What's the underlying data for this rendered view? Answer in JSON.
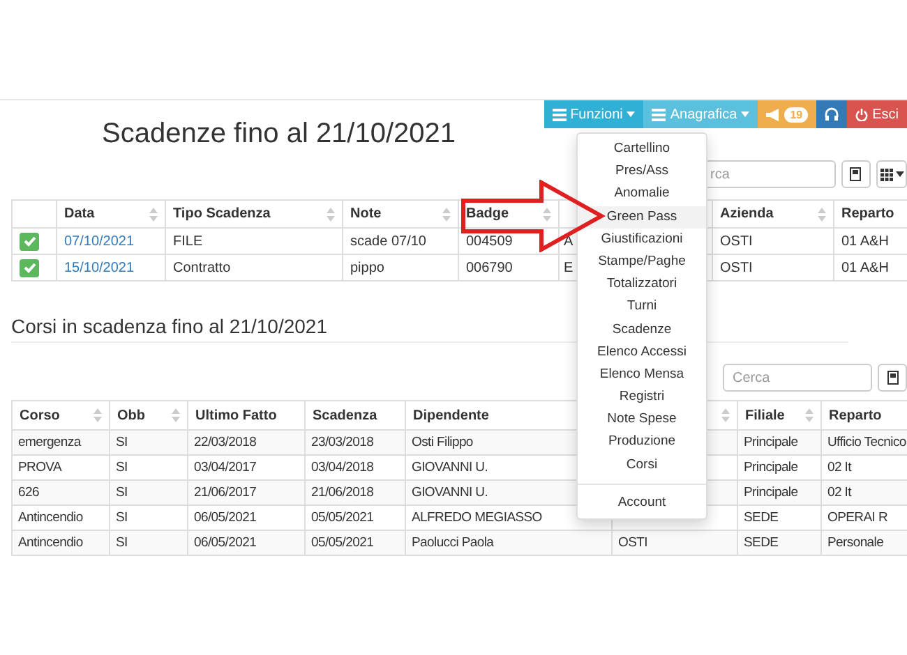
{
  "navbar": {
    "buttons": [
      {
        "kind": "menu",
        "label": "Funzioni",
        "color": "#31b0d5"
      },
      {
        "kind": "menu",
        "label": "Anagrafica",
        "color": "#5bc0de"
      },
      {
        "kind": "badge",
        "count": "19",
        "color": "#f0ad4e"
      },
      {
        "kind": "headset",
        "color": "#337ab7"
      },
      {
        "kind": "power",
        "label": "Esci",
        "color": "#d9534f"
      }
    ]
  },
  "page_title": "Scadenze fino al 21/10/2021",
  "scadenze": {
    "search": {
      "placeholder": "rca"
    },
    "columns": [
      {
        "label": "Data",
        "sortable": true
      },
      {
        "label": "Tipo Scadenza",
        "sortable": true
      },
      {
        "label": "Note",
        "sortable": true
      },
      {
        "label": "Badge",
        "sortable": true
      },
      {},
      {
        "label": "Azienda",
        "sortable": true
      },
      {
        "label": "Reparto",
        "sortable": false
      }
    ],
    "rows": [
      {
        "checked": true,
        "cells": [
          "07/10/2021",
          "FILE",
          "scade 07/10",
          "004509",
          "A",
          "OSTI",
          "01 A&H"
        ]
      },
      {
        "checked": true,
        "cells": [
          "15/10/2021",
          "Contratto",
          "pippo",
          "006790",
          "E",
          "OSTI",
          "01 A&H"
        ]
      }
    ]
  },
  "corsi": {
    "title": "Corsi in scadenza fino al 21/10/2021",
    "search": {
      "placeholder": "Cerca"
    },
    "columns": [
      {
        "label": "Corso",
        "sortable": true
      },
      {
        "label": "Obb",
        "sortable": true
      },
      {
        "label": "Ultimo Fatto",
        "sortable": false
      },
      {
        "label": "Scadenza",
        "sortable": false
      },
      {
        "label": "Dipendente"
      },
      {
        "sortable": true
      },
      {
        "label": "Filiale",
        "sortable": true
      },
      {
        "label": "Reparto",
        "sortable": false
      }
    ],
    "rows": [
      [
        "emergenza",
        "SI",
        "22/03/2018",
        "23/03/2018",
        "Osti Filippo",
        "",
        "Principale",
        "Ufficio Tecnico"
      ],
      [
        "PROVA",
        "SI",
        "03/04/2017",
        "03/04/2018",
        "GIOVANNI U.",
        "",
        "Principale",
        "02 It"
      ],
      [
        "626",
        "SI",
        "21/06/2017",
        "21/06/2018",
        "GIOVANNI U.",
        "",
        "Principale",
        "02 It"
      ],
      [
        "Antincendio",
        "SI",
        "06/05/2021",
        "05/05/2021",
        "ALFREDO MEGIASSO",
        "",
        "SEDE",
        "OPERAI R"
      ],
      [
        "Antincendio",
        "SI",
        "06/05/2021",
        "05/05/2021",
        "Paolucci Paola",
        "OSTI",
        "SEDE",
        "Personale"
      ]
    ]
  },
  "funzioni_menu": {
    "items": [
      {
        "label": "Cartellino",
        "selected": false
      },
      {
        "label": "Pres/Ass",
        "selected": false
      },
      {
        "label": "Anomalie",
        "selected": false
      },
      {
        "label": "Green Pass",
        "selected": true
      },
      {
        "label": "Giustificazioni",
        "selected": false
      },
      {
        "label": "Stampe/Paghe",
        "selected": false
      },
      {
        "label": "Totalizzatori",
        "selected": false
      },
      {
        "label": "Turni",
        "selected": false
      },
      {
        "label": "Scadenze",
        "selected": false
      },
      {
        "label": "Elenco Accessi",
        "selected": false
      },
      {
        "label": "Elenco Mensa",
        "selected": false
      },
      {
        "label": "Registri",
        "selected": false
      },
      {
        "label": "Note Spese",
        "selected": false
      },
      {
        "label": "Produzione",
        "selected": false
      },
      {
        "label": "Corsi",
        "selected": false
      }
    ],
    "footer_items": [
      {
        "label": "Account",
        "selected": false
      }
    ]
  }
}
